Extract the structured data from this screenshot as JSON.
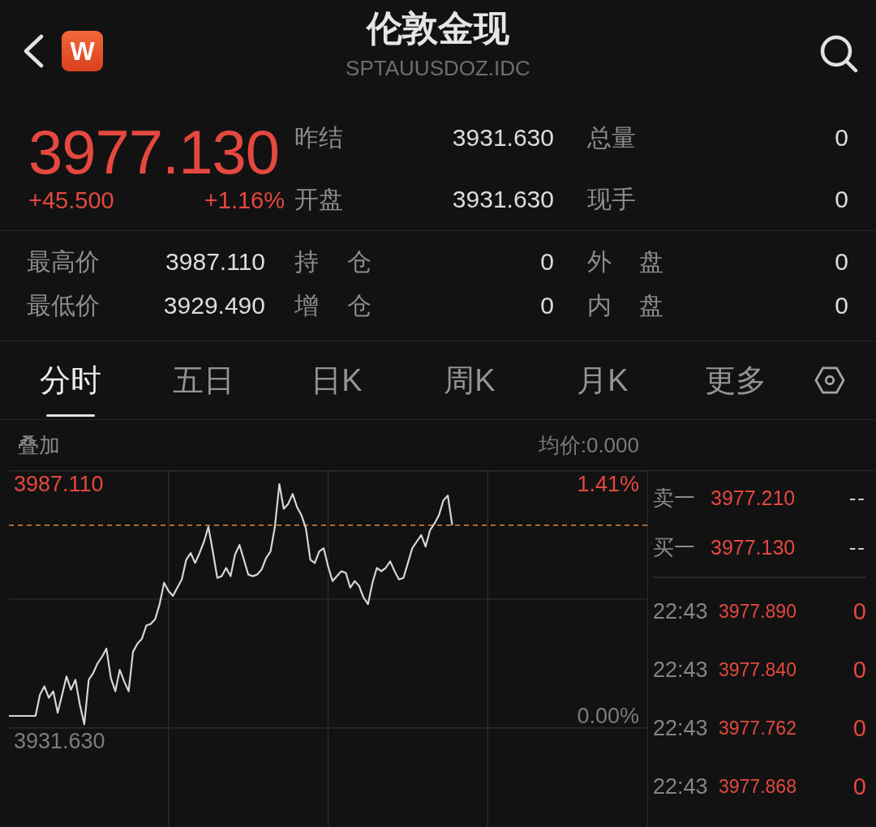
{
  "header": {
    "logo_text": "W",
    "title": "伦敦金现",
    "code": "SPTAUUSDOZ.IDC"
  },
  "quote": {
    "price": "3977.130",
    "change": "+45.500",
    "change_pct": "+1.16%",
    "up": true
  },
  "quote_fields": [
    {
      "label": "昨结",
      "value": "3931.630"
    },
    {
      "label": "总量",
      "value": "0"
    },
    {
      "label": "开盘",
      "value": "3931.630"
    },
    {
      "label": "现手",
      "value": "0"
    }
  ],
  "stats": [
    {
      "label": "最高价",
      "value": "3987.110"
    },
    {
      "label": "持 仓",
      "value": "0"
    },
    {
      "label": "外 盘",
      "value": "0"
    },
    {
      "label": "最低价",
      "value": "3929.490"
    },
    {
      "label": "增 仓",
      "value": "0"
    },
    {
      "label": "内 盘",
      "value": "0"
    }
  ],
  "tabs": [
    {
      "label": "分时",
      "selected": true
    },
    {
      "label": "五日",
      "selected": false
    },
    {
      "label": "日K",
      "selected": false
    },
    {
      "label": "周K",
      "selected": false
    },
    {
      "label": "月K",
      "selected": false
    },
    {
      "label": "更多",
      "selected": false
    }
  ],
  "chart": {
    "overlay_label": "叠加",
    "average": "均价:0.000",
    "price_labels": [
      "3987.110",
      "3931.630"
    ],
    "chart_data": {
      "type": "line",
      "values": [
        0.0,
        0.0,
        0.0,
        0.0,
        0.0,
        0.0,
        0.0,
        0.13,
        0.18,
        0.11,
        0.15,
        0.02,
        0.13,
        0.24,
        0.16,
        0.22,
        0.07,
        -0.05,
        0.22,
        0.26,
        0.32,
        0.36,
        0.41,
        0.23,
        0.15,
        0.28,
        0.21,
        0.15,
        0.39,
        0.44,
        0.47,
        0.55,
        0.56,
        0.59,
        0.68,
        0.81,
        0.76,
        0.73,
        0.78,
        0.83,
        0.95,
        0.99,
        0.93,
        0.99,
        1.06,
        1.15,
        1.0,
        0.84,
        0.85,
        0.9,
        0.85,
        0.98,
        1.04,
        0.95,
        0.86,
        0.85,
        0.86,
        0.89,
        0.96,
        1.0,
        1.15,
        1.41,
        1.26,
        1.29,
        1.35,
        1.27,
        1.22,
        1.14,
        0.95,
        0.93,
        1.0,
        1.02,
        0.91,
        0.82,
        0.85,
        0.88,
        0.87,
        0.78,
        0.82,
        0.79,
        0.72,
        0.68,
        0.81,
        0.9,
        0.88,
        0.9,
        0.94,
        0.88,
        0.83,
        0.84,
        0.93,
        1.02,
        1.06,
        1.1,
        1.03,
        1.13,
        1.17,
        1.22,
        1.31,
        1.34,
        1.16,
        null,
        null,
        null,
        null,
        null,
        null,
        null,
        null,
        null,
        null,
        null,
        null,
        null,
        null,
        null,
        null,
        null,
        null,
        null,
        null,
        null,
        null,
        null,
        null,
        null,
        null,
        null,
        null,
        null,
        null,
        null,
        null,
        null,
        null,
        null,
        null,
        null,
        null,
        null,
        null,
        null,
        null,
        null,
        null
      ],
      "ylim": [
        -0.69,
        1.494
      ],
      "yticks": [
        {
          "value": 1.41,
          "label": "1.41%"
        },
        {
          "value": 0,
          "label": "0.00%"
        }
      ],
      "ref_lines": [
        {
          "axis": "y",
          "value": 1.16
        }
      ]
    }
  },
  "order_book": [
    {
      "label": "卖一",
      "price": "3977.210",
      "volume": "--",
      "up": true
    },
    {
      "label": "买一",
      "price": "3977.130",
      "volume": "--",
      "up": true
    }
  ],
  "ticks": [
    {
      "time": "22:43",
      "price": "3977.890",
      "volume": "0",
      "up": true
    },
    {
      "time": "22:43",
      "price": "3977.840",
      "volume": "0",
      "up": true
    },
    {
      "time": "22:43",
      "price": "3977.762",
      "volume": "0",
      "up": true
    },
    {
      "time": "22:43",
      "price": "3977.868",
      "volume": "0",
      "up": true
    }
  ]
}
